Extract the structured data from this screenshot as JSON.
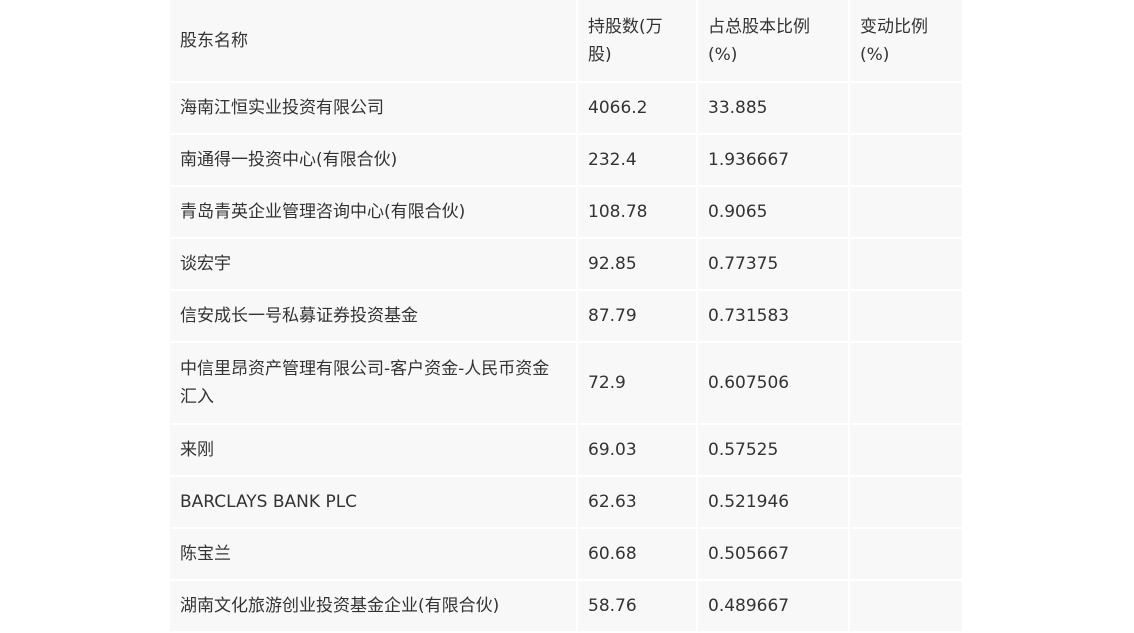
{
  "table": {
    "headers": [
      "股东名称",
      "持股数(万股)",
      "占总股本比例(%)",
      "变动比例(%)"
    ],
    "rows": [
      {
        "name": "海南江恒实业投资有限公司",
        "shares": "4066.2",
        "ratio": "33.885",
        "change": ""
      },
      {
        "name": "南通得一投资中心(有限合伙)",
        "shares": "232.4",
        "ratio": "1.936667",
        "change": ""
      },
      {
        "name": "青岛青英企业管理咨询中心(有限合伙)",
        "shares": "108.78",
        "ratio": "0.9065",
        "change": ""
      },
      {
        "name": "谈宏宇",
        "shares": "92.85",
        "ratio": "0.77375",
        "change": ""
      },
      {
        "name": "信安成长一号私募证券投资基金",
        "shares": "87.79",
        "ratio": "0.731583",
        "change": ""
      },
      {
        "name": "中信里昂资产管理有限公司-客户资金-人民币资金汇入",
        "shares": "72.9",
        "ratio": "0.607506",
        "change": ""
      },
      {
        "name": "来刚",
        "shares": "69.03",
        "ratio": "0.57525",
        "change": ""
      },
      {
        "name": "BARCLAYS BANK PLC",
        "shares": "62.63",
        "ratio": "0.521946",
        "change": ""
      },
      {
        "name": "陈宝兰",
        "shares": "60.68",
        "ratio": "0.505667",
        "change": ""
      },
      {
        "name": "湖南文化旅游创业投资基金企业(有限合伙)",
        "shares": "58.76",
        "ratio": "0.489667",
        "change": ""
      }
    ]
  }
}
